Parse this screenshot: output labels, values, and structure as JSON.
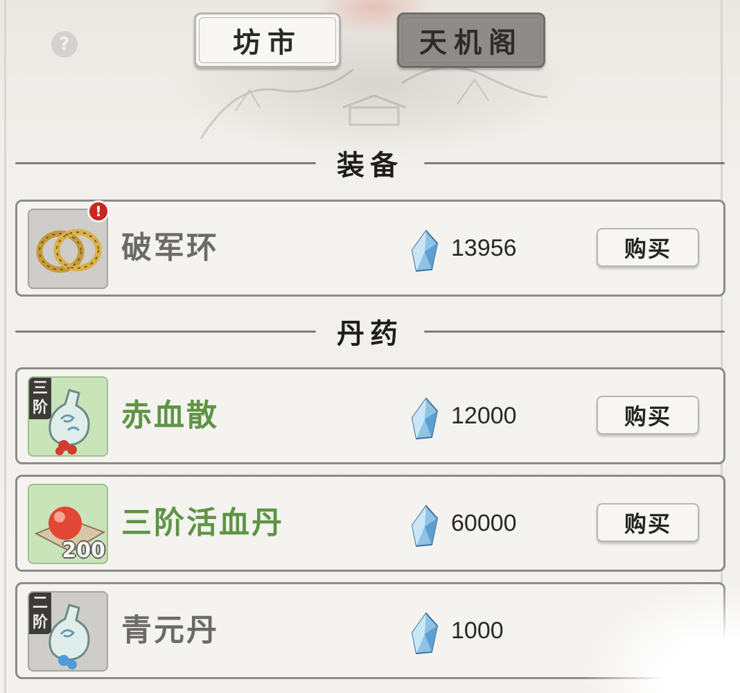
{
  "tabs": [
    {
      "label": "坊市",
      "active": true
    },
    {
      "label": "天机阁",
      "active": false
    }
  ],
  "help": {
    "glyph": "?"
  },
  "sections": [
    {
      "title": "装备"
    },
    {
      "title": "丹药"
    }
  ],
  "items": [
    {
      "name": "破军环",
      "price": "13956",
      "buy_label": "购买",
      "tier": "",
      "qty": "",
      "alert": "!",
      "icon": "gold-ring-icon",
      "name_color": "#6c6a67",
      "icon_bg": "gray"
    },
    {
      "name": "赤血散",
      "price": "12000",
      "buy_label": "购买",
      "tier": "三阶",
      "qty": "",
      "alert": "",
      "icon": "red-powder-vial-icon",
      "name_color": "#5e9443",
      "icon_bg": "green"
    },
    {
      "name": "三阶活血丹",
      "price": "60000",
      "buy_label": "购买",
      "tier": "",
      "qty": "200",
      "alert": "",
      "icon": "red-pill-icon",
      "name_color": "#5e9443",
      "icon_bg": "green"
    },
    {
      "name": "青元丹",
      "price": "1000",
      "buy_label": "",
      "tier": "二阶",
      "qty": "",
      "alert": "",
      "icon": "blue-pill-vial-icon",
      "name_color": "#6c6a67",
      "icon_bg": "gray"
    }
  ],
  "currency_icon": "spirit-stone-icon"
}
